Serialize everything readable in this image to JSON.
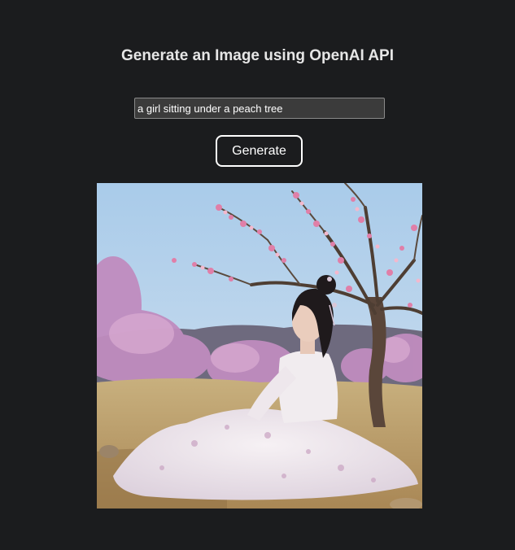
{
  "header": {
    "title": "Generate an Image using OpenAI API"
  },
  "form": {
    "prompt_value": "a girl sitting under a peach tree",
    "generate_label": "Generate"
  },
  "result": {
    "image_subject": "girl-sitting-under-peach-tree",
    "colors": {
      "sky": "#b9d6ee",
      "blossom": "#c98fc0",
      "ground": "#c9a774",
      "dress": "#ece6ee"
    }
  },
  "colors": {
    "background": "#1b1c1e",
    "input_bg": "#3b3b3b",
    "text": "#e6e6e6"
  }
}
